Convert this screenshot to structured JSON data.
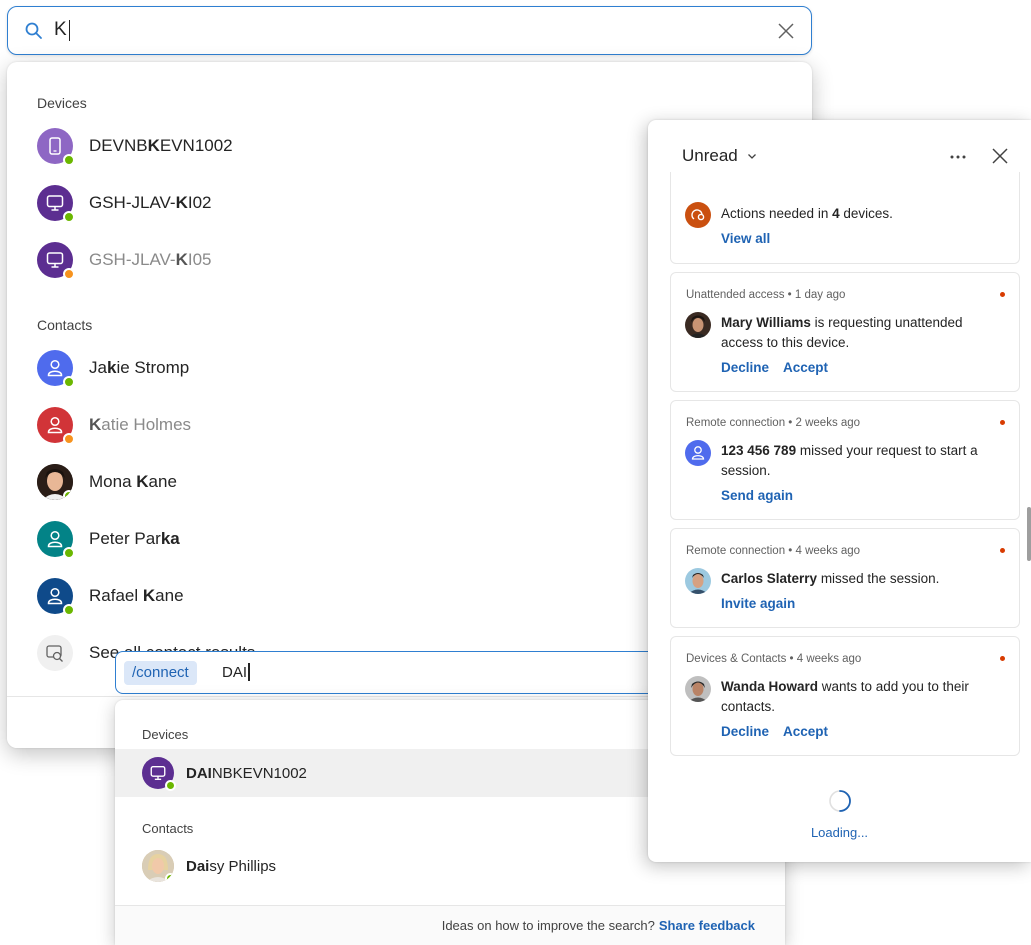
{
  "search": {
    "query": "K",
    "devices_label": "Devices",
    "devices": [
      {
        "pre": "DEVNB",
        "match": "K",
        "post": "EVN1002",
        "status": "online",
        "kind": "phone",
        "dim": false
      },
      {
        "pre": "GSH-JLAV-",
        "match": "K",
        "post": "I02",
        "status": "online",
        "kind": "monitor",
        "dim": false
      },
      {
        "pre": "GSH-JLAV-",
        "match": "K",
        "post": "I05",
        "status": "away",
        "kind": "monitor",
        "dim": true
      }
    ],
    "contacts_label": "Contacts",
    "contacts": [
      {
        "pre": "Ja",
        "match": "k",
        "post": "ie Stromp",
        "status": "online",
        "color": "#4f6bed",
        "dim": false
      },
      {
        "pre": "",
        "match": "K",
        "post": "atie Holmes",
        "status": "away",
        "color": "#d13438",
        "dim": true
      },
      {
        "pre": "Mona ",
        "match": "K",
        "post": "ane",
        "status": "online",
        "photo": true,
        "dim": false
      },
      {
        "pre": "Peter Par",
        "match": "ka",
        "post": "",
        "status": "online",
        "color": "#038387",
        "dim": false
      },
      {
        "pre": "Rafael ",
        "match": "K",
        "post": "ane",
        "status": "online",
        "color": "#0f4a8a",
        "dim": false
      }
    ],
    "see_all": "See all contact results"
  },
  "connect": {
    "command": "/connect",
    "query": "DAI",
    "devices_label": "Devices",
    "device": {
      "match": "DAI",
      "post": "NBKEVN1002"
    },
    "contacts_label": "Contacts",
    "contact": {
      "match": "Dai",
      "post": "sy Phillips"
    },
    "footer_text": "Ideas on how to improve the search?",
    "footer_link": "Share feedback"
  },
  "notifications": {
    "filter": "Unread",
    "cards": [
      {
        "type": "actions",
        "pre": "Actions needed in ",
        "count": "4",
        "post": " devices.",
        "action": "View all"
      },
      {
        "meta": "Unattended access  •  1 day ago",
        "name": "Mary Williams",
        "text": " is requesting unattended access to this device.",
        "actions": [
          "Decline",
          "Accept"
        ]
      },
      {
        "meta": "Remote connection  •  2 weeks ago",
        "name": "123 456 789",
        "text": " missed your request to start a session.",
        "actions": [
          "Send again"
        ]
      },
      {
        "meta": "Remote connection  •  4 weeks ago",
        "name": "Carlos Slaterry",
        "text": " missed the session.",
        "actions": [
          "Invite again"
        ]
      },
      {
        "meta": "Devices & Contacts  •  4 weeks ago",
        "name": "Wanda Howard",
        "text": " wants to add you to their contacts.",
        "actions": [
          "Decline",
          "Accept"
        ]
      }
    ],
    "loading": "Loading..."
  },
  "colors": {
    "accent": "#1f63b3",
    "device_purple": "#5c2e91",
    "online": "#6bb700",
    "away": "#f7931e",
    "unread_dot": "#d83b01"
  }
}
